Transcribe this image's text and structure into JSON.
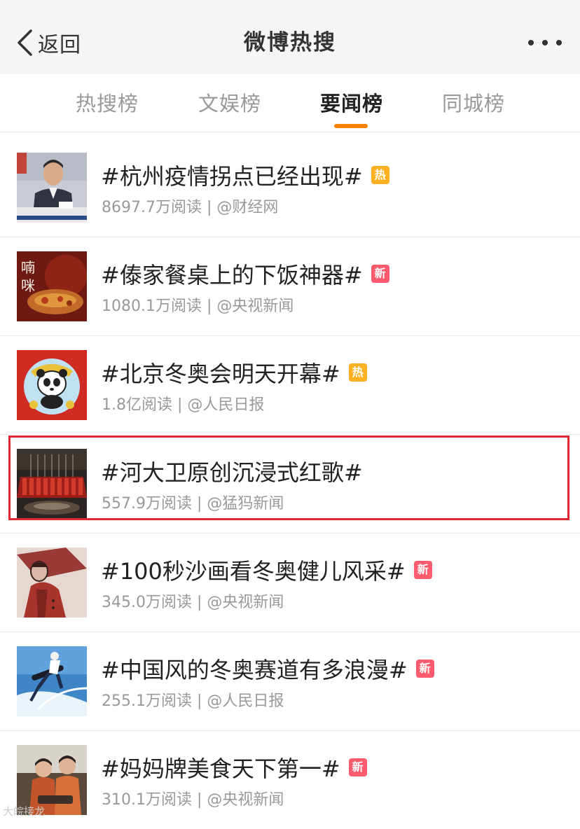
{
  "header": {
    "back_label": "返回",
    "title": "微博热搜"
  },
  "tabs": [
    {
      "label": "热搜榜",
      "active": false
    },
    {
      "label": "文娱榜",
      "active": false
    },
    {
      "label": "要闻榜",
      "active": true
    },
    {
      "label": "同城榜",
      "active": false
    }
  ],
  "items": [
    {
      "title": "#杭州疫情拐点已经出现#",
      "badge": "热",
      "badge_type": "hot",
      "reads": "8697.7万阅读",
      "source": "@财经网",
      "thumb_icon": "press-conference-photo"
    },
    {
      "title": "#傣家餐桌上的下饭神器#",
      "badge": "新",
      "badge_type": "new",
      "reads": "1080.1万阅读",
      "source": "@央视新闻",
      "thumb_icon": "food-photo",
      "thumb_text": [
        "喃",
        "咪"
      ]
    },
    {
      "title": "#北京冬奥会明天开幕#",
      "badge": "热",
      "badge_type": "hot",
      "reads": "1.8亿阅读",
      "source": "@人民日报",
      "thumb_icon": "panda-illustration"
    },
    {
      "title": "#河大卫原创沉浸式红歌#",
      "badge": "",
      "badge_type": "",
      "reads": "557.9万阅读",
      "source": "@猛犸新闻",
      "thumb_icon": "choir-stage-photo"
    },
    {
      "title": "#100秒沙画看冬奥健儿风采#",
      "badge": "新",
      "badge_type": "new",
      "reads": "345.0万阅读",
      "source": "@央视新闻",
      "thumb_icon": "sand-painting-photo"
    },
    {
      "title": "#中国风的冬奥赛道有多浪漫#",
      "badge": "新",
      "badge_type": "new",
      "reads": "255.1万阅读",
      "source": "@人民日报",
      "thumb_icon": "snowboard-photo"
    },
    {
      "title": "#妈妈牌美食天下第一#",
      "badge": "新",
      "badge_type": "new",
      "reads": "310.1万阅读",
      "source": "@央视新闻",
      "thumb_icon": "cooking-photo"
    }
  ],
  "watermark": "大皖接龙",
  "colors": {
    "accent": "#ff8200",
    "hot_badge": "#ffb021",
    "new_badge": "#ff5b6f",
    "highlight_box": "#e0262f"
  }
}
